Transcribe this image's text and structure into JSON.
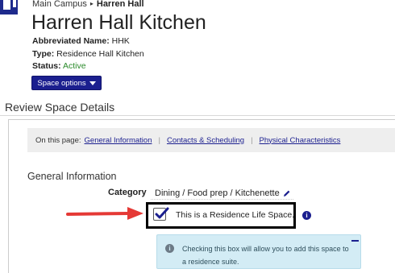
{
  "breadcrumb": {
    "items": [
      "Main Campus",
      "Harren Hall"
    ],
    "separator": "▸"
  },
  "header": {
    "title": "Harren Hall Kitchen",
    "abbrev_label": "Abbreviated Name:",
    "abbrev_value": "HHK",
    "type_label": "Type:",
    "type_value": "Residence Hall Kitchen",
    "status_label": "Status:",
    "status_value": "Active",
    "space_options_label": "Space options"
  },
  "section": {
    "title": "Review Space Details"
  },
  "onpage": {
    "label": "On this page:",
    "links": [
      "General Information",
      "Contacts & Scheduling",
      "Physical Characteristics"
    ]
  },
  "general": {
    "title": "General Information",
    "category_label": "Category",
    "category_value": "Dining / Food prep / Kitchenette",
    "reslife_label": "This is a Residence Life Space.",
    "reslife_checked": true,
    "notice_text": "Checking this box will allow you to add this space to a residence suite."
  },
  "icons": {
    "info": "info-icon",
    "pencil": "pencil-icon",
    "check": "check-icon",
    "arrow": "red-arrow-annotation"
  },
  "colors": {
    "brand": "#1b1f8f",
    "status_active": "#2a8a2a",
    "notice_bg": "#d3ecf5",
    "annotation_arrow": "#e53935"
  }
}
